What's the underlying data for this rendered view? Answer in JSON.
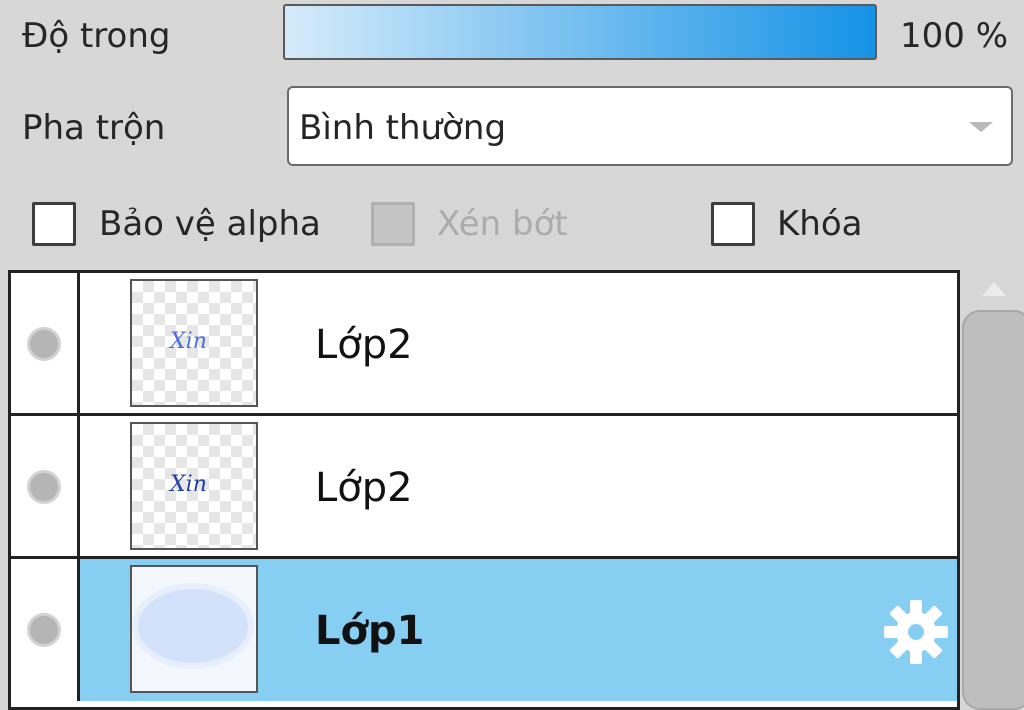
{
  "opacity": {
    "label": "Độ trong",
    "value_text": "100 %",
    "value": 1.0
  },
  "blend": {
    "label": "Pha trộn",
    "value": "Bình thường"
  },
  "options": {
    "protect_alpha": {
      "label": "Bảo vệ alpha",
      "checked": false,
      "enabled": true
    },
    "clip": {
      "label": "Xén bớt",
      "checked": false,
      "enabled": false
    },
    "lock": {
      "label": "Khóa",
      "checked": false,
      "enabled": true
    }
  },
  "layers": [
    {
      "name": "Lớp2",
      "thumb_text": "Xin",
      "thumb_color": "#4a6fe0",
      "selected": false
    },
    {
      "name": "Lớp2",
      "thumb_text": "Xin",
      "thumb_color": "#1f3fa8",
      "selected": false
    },
    {
      "name": "Lớp1",
      "selected": true,
      "icon": "gear-icon"
    }
  ],
  "colors": {
    "selected_row": "#86cff3",
    "opacity_bar_end": "#1592e6"
  }
}
